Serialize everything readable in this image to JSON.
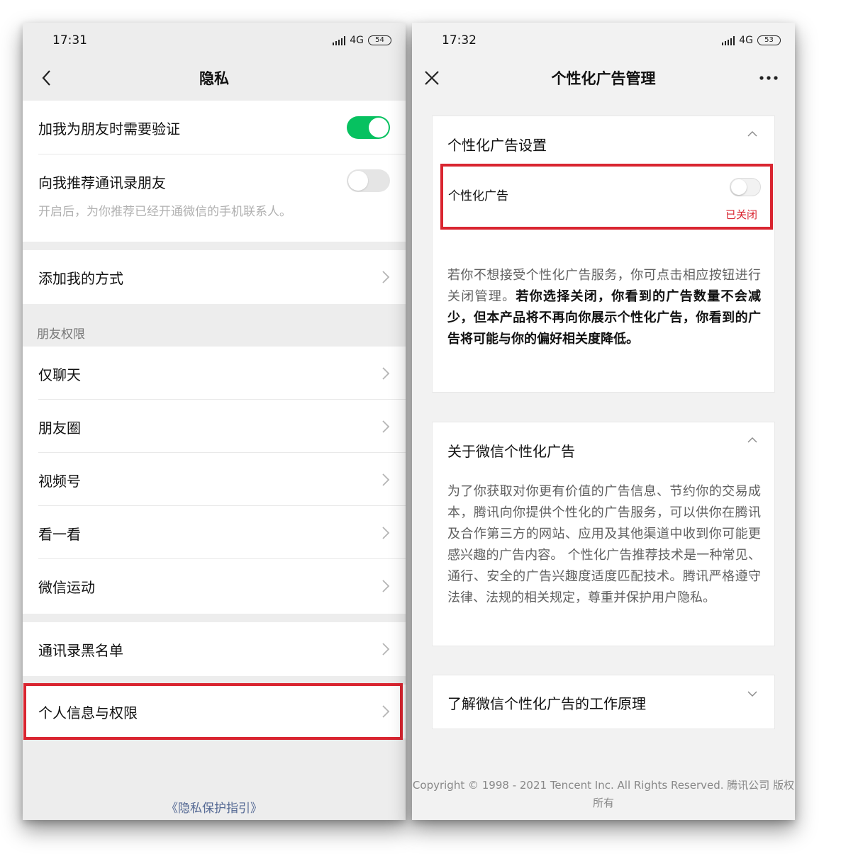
{
  "left_screen": {
    "time": "17:31",
    "network": "4G",
    "battery": "54",
    "title": "隐私",
    "verify_label": "加我为朋友时需要验证",
    "recommend_label": "向我推荐通讯录朋友",
    "recommend_desc": "开启后，为你推荐已经开通微信的手机联系人。",
    "add_me_label": "添加我的方式",
    "section_header": "朋友权限",
    "friend_items": [
      "仅聊天",
      "朋友圈",
      "视频号",
      "看一看",
      "微信运动"
    ],
    "blacklist_label": "通讯录黑名单",
    "personal_info_label": "个人信息与权限",
    "footer_link": "《隐私保护指引》"
  },
  "right_screen": {
    "time": "17:32",
    "network": "4G",
    "battery": "53",
    "title": "个性化广告管理",
    "settings_card": {
      "title": "个性化广告设置",
      "toggle_label": "个性化广告",
      "status": "已关闭",
      "desc_normal": "若你不想接受个性化广告服务，你可点击相应按钮进行关闭管理。",
      "desc_bold": "若你选择关闭，你看到的广告数量不会减少，但本产品将不再向你展示个性化广告，你看到的广告将可能与你的偏好相关度降低。"
    },
    "about_card": {
      "title": "关于微信个性化广告",
      "body": "为了你获取对你更有价值的广告信息、节约你的交易成本，腾讯向你提供个性化的广告服务，可以供你在腾讯及合作第三方的网站、应用及其他渠道中收到你可能更感兴趣的广告内容。 个性化广告推荐技术是一种常见、通行、安全的广告兴趣度适度匹配技术。腾讯严格遵守法律、法规的相关规定，尊重并保护用户隐私。"
    },
    "learn_card": {
      "title": "了解微信个性化广告的工作原理"
    },
    "copyright": "Copyright © 1998 - 2021 Tencent Inc. All Rights Reserved. 腾讯公司 版权所有"
  },
  "colors": {
    "toggle_on": "#07c160",
    "highlight": "#d92530",
    "link": "#576b95",
    "background": "#ededed"
  }
}
